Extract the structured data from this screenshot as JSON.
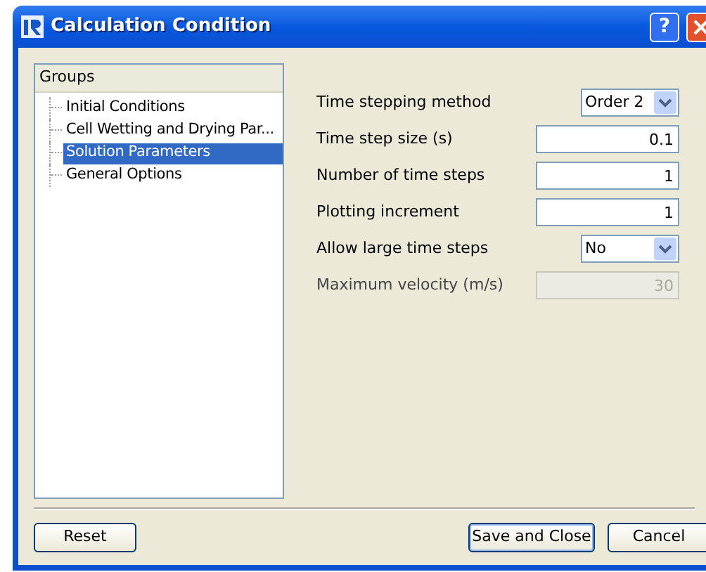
{
  "window": {
    "title": "Calculation Condition",
    "help_button": "?"
  },
  "groups": {
    "header": "Groups",
    "items": [
      {
        "label": "Initial Conditions",
        "selected": false
      },
      {
        "label": "Cell Wetting and Drying Par...",
        "selected": false
      },
      {
        "label": "Solution Parameters",
        "selected": true
      },
      {
        "label": "General Options",
        "selected": false
      }
    ]
  },
  "fields": [
    {
      "label": "Time stepping method",
      "kind": "combo",
      "value": "Order 2",
      "disabled": false
    },
    {
      "label": "Time step size (s)",
      "kind": "text",
      "value": "0.1",
      "disabled": false
    },
    {
      "label": "Number of time steps",
      "kind": "text",
      "value": "1",
      "disabled": false
    },
    {
      "label": "Plotting increment",
      "kind": "text",
      "value": "1",
      "disabled": false
    },
    {
      "label": "Allow large time steps",
      "kind": "combo",
      "value": "No",
      "disabled": false
    },
    {
      "label": "Maximum velocity (m/s)",
      "kind": "text",
      "value": "30",
      "disabled": true
    }
  ],
  "buttons": [
    {
      "label": "Reset",
      "default": false
    },
    {
      "label": "Save and Close",
      "default": true
    },
    {
      "label": "Cancel",
      "default": false
    }
  ]
}
